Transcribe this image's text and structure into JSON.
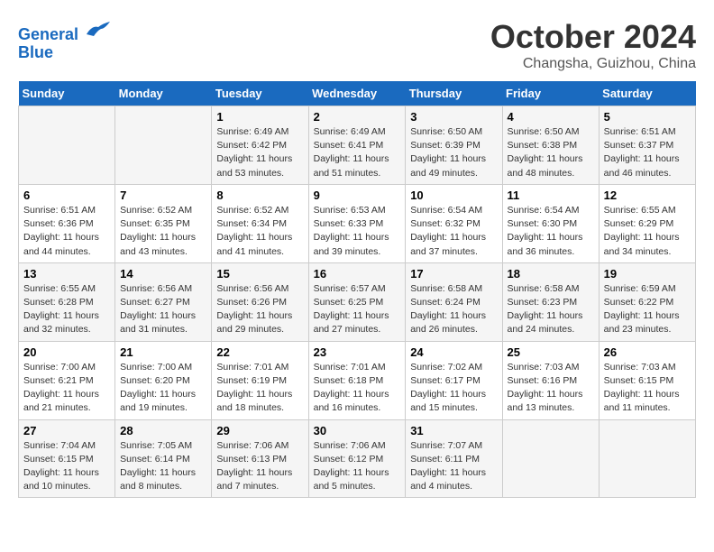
{
  "header": {
    "logo_line1": "General",
    "logo_line2": "Blue",
    "month": "October 2024",
    "location": "Changsha, Guizhou, China"
  },
  "weekdays": [
    "Sunday",
    "Monday",
    "Tuesday",
    "Wednesday",
    "Thursday",
    "Friday",
    "Saturday"
  ],
  "weeks": [
    [
      {
        "day": "",
        "sunrise": "",
        "sunset": "",
        "daylight": ""
      },
      {
        "day": "",
        "sunrise": "",
        "sunset": "",
        "daylight": ""
      },
      {
        "day": "1",
        "sunrise": "Sunrise: 6:49 AM",
        "sunset": "Sunset: 6:42 PM",
        "daylight": "Daylight: 11 hours and 53 minutes."
      },
      {
        "day": "2",
        "sunrise": "Sunrise: 6:49 AM",
        "sunset": "Sunset: 6:41 PM",
        "daylight": "Daylight: 11 hours and 51 minutes."
      },
      {
        "day": "3",
        "sunrise": "Sunrise: 6:50 AM",
        "sunset": "Sunset: 6:39 PM",
        "daylight": "Daylight: 11 hours and 49 minutes."
      },
      {
        "day": "4",
        "sunrise": "Sunrise: 6:50 AM",
        "sunset": "Sunset: 6:38 PM",
        "daylight": "Daylight: 11 hours and 48 minutes."
      },
      {
        "day": "5",
        "sunrise": "Sunrise: 6:51 AM",
        "sunset": "Sunset: 6:37 PM",
        "daylight": "Daylight: 11 hours and 46 minutes."
      }
    ],
    [
      {
        "day": "6",
        "sunrise": "Sunrise: 6:51 AM",
        "sunset": "Sunset: 6:36 PM",
        "daylight": "Daylight: 11 hours and 44 minutes."
      },
      {
        "day": "7",
        "sunrise": "Sunrise: 6:52 AM",
        "sunset": "Sunset: 6:35 PM",
        "daylight": "Daylight: 11 hours and 43 minutes."
      },
      {
        "day": "8",
        "sunrise": "Sunrise: 6:52 AM",
        "sunset": "Sunset: 6:34 PM",
        "daylight": "Daylight: 11 hours and 41 minutes."
      },
      {
        "day": "9",
        "sunrise": "Sunrise: 6:53 AM",
        "sunset": "Sunset: 6:33 PM",
        "daylight": "Daylight: 11 hours and 39 minutes."
      },
      {
        "day": "10",
        "sunrise": "Sunrise: 6:54 AM",
        "sunset": "Sunset: 6:32 PM",
        "daylight": "Daylight: 11 hours and 37 minutes."
      },
      {
        "day": "11",
        "sunrise": "Sunrise: 6:54 AM",
        "sunset": "Sunset: 6:30 PM",
        "daylight": "Daylight: 11 hours and 36 minutes."
      },
      {
        "day": "12",
        "sunrise": "Sunrise: 6:55 AM",
        "sunset": "Sunset: 6:29 PM",
        "daylight": "Daylight: 11 hours and 34 minutes."
      }
    ],
    [
      {
        "day": "13",
        "sunrise": "Sunrise: 6:55 AM",
        "sunset": "Sunset: 6:28 PM",
        "daylight": "Daylight: 11 hours and 32 minutes."
      },
      {
        "day": "14",
        "sunrise": "Sunrise: 6:56 AM",
        "sunset": "Sunset: 6:27 PM",
        "daylight": "Daylight: 11 hours and 31 minutes."
      },
      {
        "day": "15",
        "sunrise": "Sunrise: 6:56 AM",
        "sunset": "Sunset: 6:26 PM",
        "daylight": "Daylight: 11 hours and 29 minutes."
      },
      {
        "day": "16",
        "sunrise": "Sunrise: 6:57 AM",
        "sunset": "Sunset: 6:25 PM",
        "daylight": "Daylight: 11 hours and 27 minutes."
      },
      {
        "day": "17",
        "sunrise": "Sunrise: 6:58 AM",
        "sunset": "Sunset: 6:24 PM",
        "daylight": "Daylight: 11 hours and 26 minutes."
      },
      {
        "day": "18",
        "sunrise": "Sunrise: 6:58 AM",
        "sunset": "Sunset: 6:23 PM",
        "daylight": "Daylight: 11 hours and 24 minutes."
      },
      {
        "day": "19",
        "sunrise": "Sunrise: 6:59 AM",
        "sunset": "Sunset: 6:22 PM",
        "daylight": "Daylight: 11 hours and 23 minutes."
      }
    ],
    [
      {
        "day": "20",
        "sunrise": "Sunrise: 7:00 AM",
        "sunset": "Sunset: 6:21 PM",
        "daylight": "Daylight: 11 hours and 21 minutes."
      },
      {
        "day": "21",
        "sunrise": "Sunrise: 7:00 AM",
        "sunset": "Sunset: 6:20 PM",
        "daylight": "Daylight: 11 hours and 19 minutes."
      },
      {
        "day": "22",
        "sunrise": "Sunrise: 7:01 AM",
        "sunset": "Sunset: 6:19 PM",
        "daylight": "Daylight: 11 hours and 18 minutes."
      },
      {
        "day": "23",
        "sunrise": "Sunrise: 7:01 AM",
        "sunset": "Sunset: 6:18 PM",
        "daylight": "Daylight: 11 hours and 16 minutes."
      },
      {
        "day": "24",
        "sunrise": "Sunrise: 7:02 AM",
        "sunset": "Sunset: 6:17 PM",
        "daylight": "Daylight: 11 hours and 15 minutes."
      },
      {
        "day": "25",
        "sunrise": "Sunrise: 7:03 AM",
        "sunset": "Sunset: 6:16 PM",
        "daylight": "Daylight: 11 hours and 13 minutes."
      },
      {
        "day": "26",
        "sunrise": "Sunrise: 7:03 AM",
        "sunset": "Sunset: 6:15 PM",
        "daylight": "Daylight: 11 hours and 11 minutes."
      }
    ],
    [
      {
        "day": "27",
        "sunrise": "Sunrise: 7:04 AM",
        "sunset": "Sunset: 6:15 PM",
        "daylight": "Daylight: 11 hours and 10 minutes."
      },
      {
        "day": "28",
        "sunrise": "Sunrise: 7:05 AM",
        "sunset": "Sunset: 6:14 PM",
        "daylight": "Daylight: 11 hours and 8 minutes."
      },
      {
        "day": "29",
        "sunrise": "Sunrise: 7:06 AM",
        "sunset": "Sunset: 6:13 PM",
        "daylight": "Daylight: 11 hours and 7 minutes."
      },
      {
        "day": "30",
        "sunrise": "Sunrise: 7:06 AM",
        "sunset": "Sunset: 6:12 PM",
        "daylight": "Daylight: 11 hours and 5 minutes."
      },
      {
        "day": "31",
        "sunrise": "Sunrise: 7:07 AM",
        "sunset": "Sunset: 6:11 PM",
        "daylight": "Daylight: 11 hours and 4 minutes."
      },
      {
        "day": "",
        "sunrise": "",
        "sunset": "",
        "daylight": ""
      },
      {
        "day": "",
        "sunrise": "",
        "sunset": "",
        "daylight": ""
      }
    ]
  ]
}
